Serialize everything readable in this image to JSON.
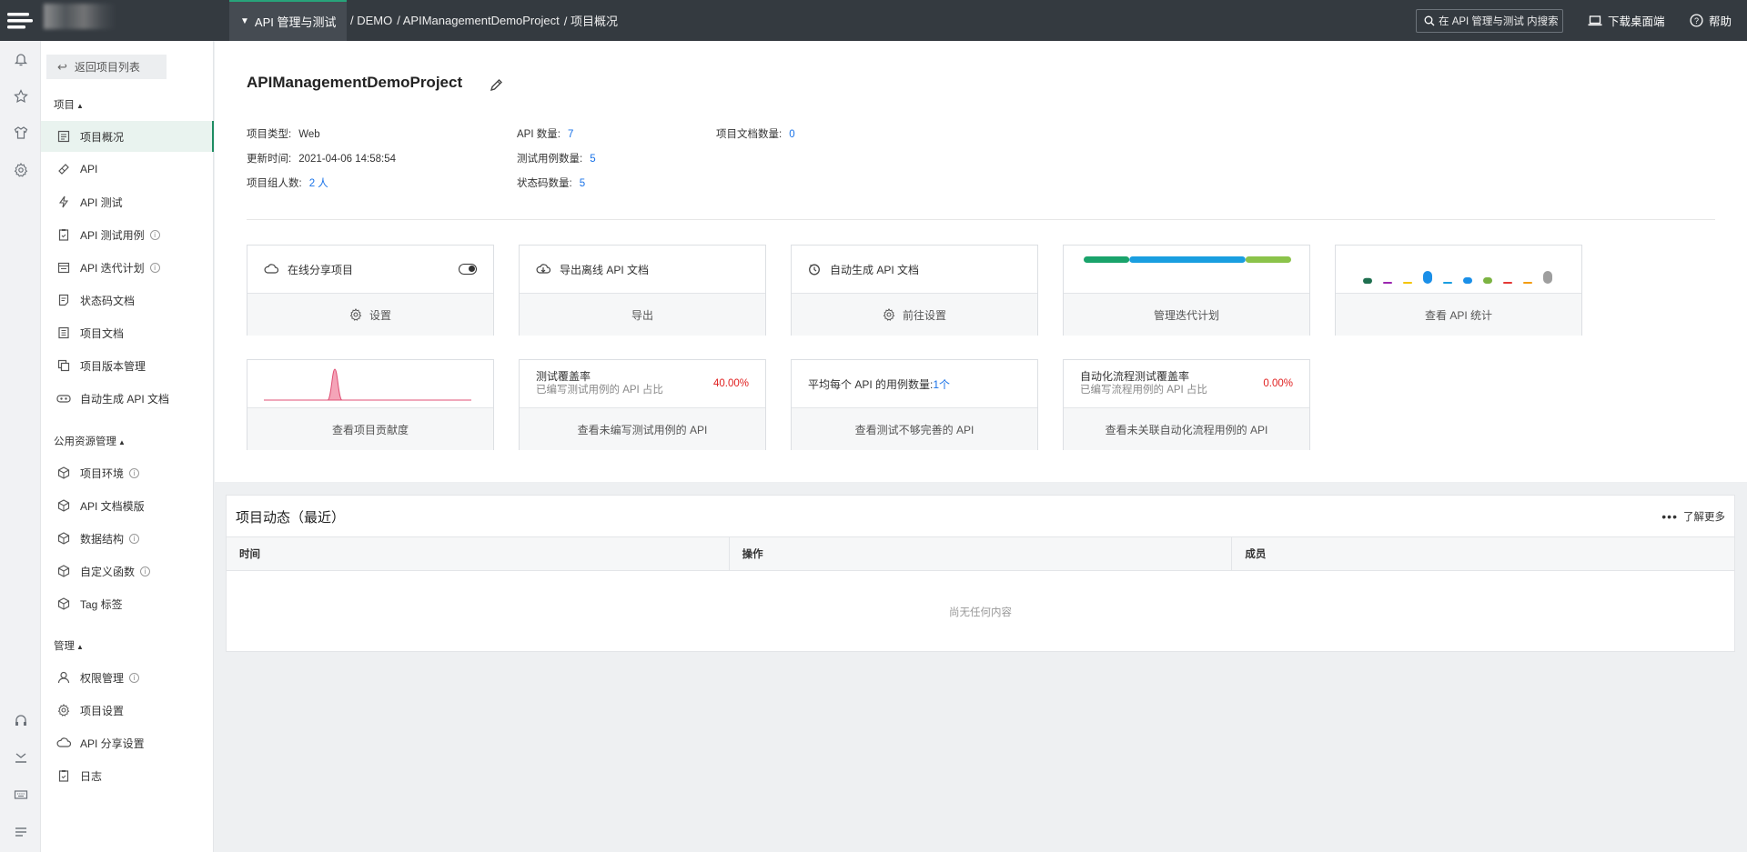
{
  "topbar": {
    "module_label": "API 管理与测试",
    "breadcrumb": [
      "/ DEMO",
      "/ APIManagementDemoProject",
      "/ 项目概况"
    ],
    "search_placeholder": "在 API 管理与测试 内搜索",
    "download_label": "下载桌面端",
    "help_label": "帮助"
  },
  "sidebar": {
    "back_label": "返回项目列表",
    "sections": [
      {
        "title": "项目",
        "items": [
          {
            "label": "项目概况",
            "icon": "overview-icon",
            "active": true
          },
          {
            "label": "API",
            "icon": "api-icon"
          },
          {
            "label": "API 测试",
            "icon": "lightning-icon"
          },
          {
            "label": "API 测试用例",
            "icon": "clipboard-icon",
            "info": true
          },
          {
            "label": "API 迭代计划",
            "icon": "calendar-icon",
            "info": true
          },
          {
            "label": "状态码文档",
            "icon": "doc-icon"
          },
          {
            "label": "项目文档",
            "icon": "book-icon"
          },
          {
            "label": "项目版本管理",
            "icon": "copy-icon"
          },
          {
            "label": "自动生成 API 文档",
            "icon": "robot-icon"
          }
        ]
      },
      {
        "title": "公用资源管理",
        "items": [
          {
            "label": "项目环境",
            "icon": "cube-icon",
            "info": true
          },
          {
            "label": "API 文档模版",
            "icon": "cube-icon"
          },
          {
            "label": "数据结构",
            "icon": "cube-icon",
            "info": true
          },
          {
            "label": "自定义函数",
            "icon": "cube-icon",
            "info": true
          },
          {
            "label": "Tag 标签",
            "icon": "cube-icon"
          }
        ]
      },
      {
        "title": "管理",
        "items": [
          {
            "label": "权限管理",
            "icon": "user-icon",
            "info": true
          },
          {
            "label": "项目设置",
            "icon": "gear-icon"
          },
          {
            "label": "API 分享设置",
            "icon": "cloud-icon"
          },
          {
            "label": "日志",
            "icon": "log-icon"
          }
        ]
      }
    ]
  },
  "project": {
    "name": "APIManagementDemoProject",
    "type_label": "项目类型:",
    "type_value": "Web",
    "updated_label": "更新时间:",
    "updated_value": "2021-04-06 14:58:54",
    "members_label": "项目组人数:",
    "members_value": "2 人",
    "api_count_label": "API 数量:",
    "api_count_value": "7",
    "testcase_label": "测试用例数量:",
    "testcase_value": "5",
    "statuscode_label": "状态码数量:",
    "statuscode_value": "5",
    "docs_label": "项目文档数量:",
    "docs_value": "0"
  },
  "cards": {
    "share": {
      "title": "在线分享项目",
      "action": "设置"
    },
    "export": {
      "title": "导出离线 API 文档",
      "action": "导出"
    },
    "autogen": {
      "title": "自动生成 API 文档",
      "action": "前往设置"
    },
    "iteration": {
      "action": "管理迭代计划"
    },
    "stats": {
      "action": "查看 API 统计"
    },
    "contrib": {
      "action": "查看项目贡献度"
    },
    "coverage": {
      "title": "测试覆盖率",
      "sub": "已编写测试用例的 API 占比",
      "pct": "40.00%",
      "action": "查看未编写测试用例的 API"
    },
    "avg": {
      "title": "平均每个 API 的用例数量:",
      "value": "1个",
      "action": "查看测试不够完善的 API"
    },
    "flow": {
      "title": "自动化流程测试覆盖率",
      "sub": "已编写流程用例的 API 占比",
      "pct": "0.00%",
      "action": "查看未关联自动化流程用例的 API"
    }
  },
  "iteration_bar": [
    {
      "fraction": 0.22,
      "color": "#1aa36b"
    },
    {
      "fraction": 0.56,
      "color": "#1a9ee0"
    },
    {
      "fraction": 0.22,
      "color": "#8bc34a"
    }
  ],
  "stats_bars": [
    {
      "level": 0.45,
      "color": "#1e6f4f"
    },
    {
      "level": 0.1,
      "color": "#9c27b0"
    },
    {
      "level": 0.1,
      "color": "#f5c400"
    },
    {
      "level": 1.0,
      "color": "#1a8fe8"
    },
    {
      "level": 0.1,
      "color": "#1a9ee0"
    },
    {
      "level": 0.5,
      "color": "#1a8fe8"
    },
    {
      "level": 0.5,
      "color": "#7cb342"
    },
    {
      "level": 0.1,
      "color": "#e53935"
    },
    {
      "level": 0.1,
      "color": "#f39c12"
    },
    {
      "level": 1.0,
      "color": "#9e9e9e"
    }
  ],
  "activity": {
    "title": "项目动态（最近）",
    "more_label": "了解更多",
    "columns": [
      "时间",
      "操作",
      "成员"
    ],
    "empty_text": "尚无任何内容"
  }
}
